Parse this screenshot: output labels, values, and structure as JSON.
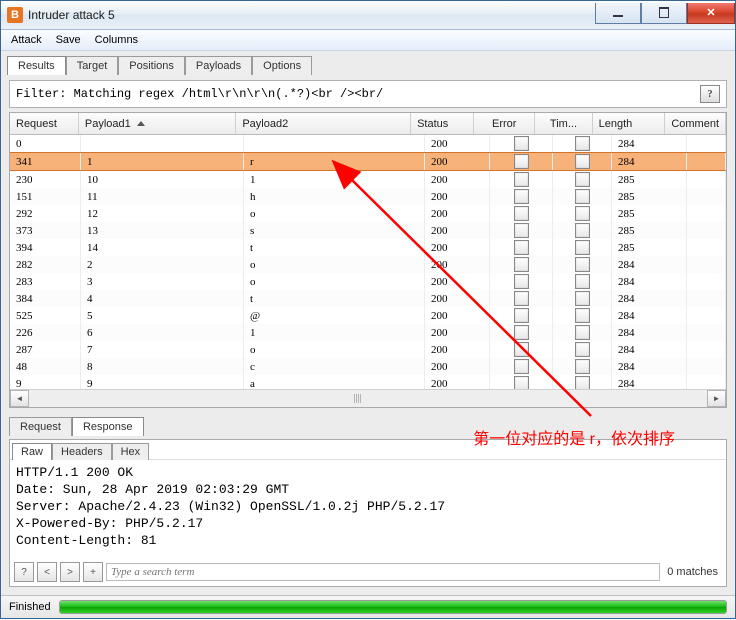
{
  "window": {
    "title": "Intruder attack 5"
  },
  "menu": {
    "attack": "Attack",
    "save": "Save",
    "columns": "Columns"
  },
  "tabs": {
    "results": "Results",
    "target": "Target",
    "positions": "Positions",
    "payloads": "Payloads",
    "options": "Options"
  },
  "filter": {
    "text": "Filter: Matching regex /html\\r\\n\\r\\n(.*?)<br /><br/"
  },
  "headers": {
    "request": "Request",
    "payload1": "Payload1",
    "payload2": "Payload2",
    "status": "Status",
    "error": "Error",
    "timeout": "Tim...",
    "length": "Length",
    "comment": "Comment"
  },
  "rows": [
    {
      "req": "0",
      "p1": "",
      "p2": "",
      "st": "200",
      "len": "284",
      "sel": false
    },
    {
      "req": "341",
      "p1": "1",
      "p2": "r",
      "st": "200",
      "len": "284",
      "sel": true
    },
    {
      "req": "230",
      "p1": "10",
      "p2": "1",
      "st": "200",
      "len": "285",
      "sel": false
    },
    {
      "req": "151",
      "p1": "11",
      "p2": "h",
      "st": "200",
      "len": "285",
      "sel": false
    },
    {
      "req": "292",
      "p1": "12",
      "p2": "o",
      "st": "200",
      "len": "285",
      "sel": false
    },
    {
      "req": "373",
      "p1": "13",
      "p2": "s",
      "st": "200",
      "len": "285",
      "sel": false
    },
    {
      "req": "394",
      "p1": "14",
      "p2": "t",
      "st": "200",
      "len": "285",
      "sel": false
    },
    {
      "req": "282",
      "p1": "2",
      "p2": "o",
      "st": "200",
      "len": "284",
      "sel": false
    },
    {
      "req": "283",
      "p1": "3",
      "p2": "o",
      "st": "200",
      "len": "284",
      "sel": false
    },
    {
      "req": "384",
      "p1": "4",
      "p2": "t",
      "st": "200",
      "len": "284",
      "sel": false
    },
    {
      "req": "525",
      "p1": "5",
      "p2": "@",
      "st": "200",
      "len": "284",
      "sel": false
    },
    {
      "req": "226",
      "p1": "6",
      "p2": "1",
      "st": "200",
      "len": "284",
      "sel": false
    },
    {
      "req": "287",
      "p1": "7",
      "p2": "o",
      "st": "200",
      "len": "284",
      "sel": false
    },
    {
      "req": "48",
      "p1": "8",
      "p2": "c",
      "st": "200",
      "len": "284",
      "sel": false
    },
    {
      "req": "9",
      "p1": "9",
      "p2": "a",
      "st": "200",
      "len": "284",
      "sel": false
    }
  ],
  "midtabs": {
    "request": "Request",
    "response": "Response"
  },
  "resp_sub": {
    "raw": "Raw",
    "headers": "Headers",
    "hex": "Hex"
  },
  "response_lines": [
    "HTTP/1.1 200 OK",
    "Date: Sun, 28 Apr 2019 02:03:29 GMT",
    "Server: Apache/2.4.23 (Win32) OpenSSL/1.0.2j PHP/5.2.17",
    "X-Powered-By: PHP/5.2.17",
    "Content-Length: 81"
  ],
  "search": {
    "placeholder": "Type a search term",
    "matches": "0 matches"
  },
  "status": {
    "text": "Finished"
  },
  "annotation": "第一位对应的是 r，依次排序"
}
